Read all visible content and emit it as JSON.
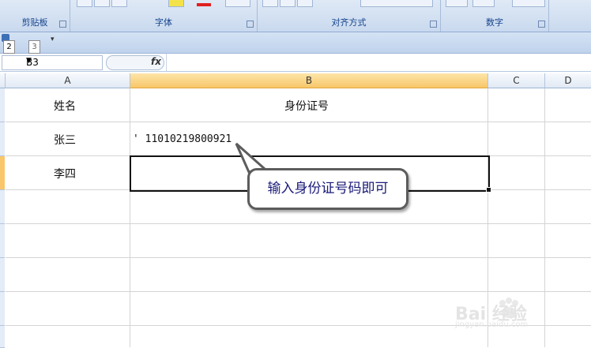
{
  "ribbon": {
    "groups": [
      {
        "label": "剪贴板"
      },
      {
        "label": "字体"
      },
      {
        "label": "对齐方式"
      },
      {
        "label": "数字"
      }
    ]
  },
  "quick_access": {
    "keytips": [
      "2",
      "3"
    ]
  },
  "formula_bar": {
    "name_box": "B3",
    "fx_label": "fx",
    "content": ""
  },
  "grid": {
    "columns": [
      "A",
      "B",
      "C",
      "D"
    ],
    "selected_column": "B",
    "cells": {
      "A1": "姓名",
      "B1": "身份证号",
      "A2": "张三",
      "B2": "' 11010219800921",
      "A3": "李四"
    },
    "active_cell": "B3"
  },
  "callout": {
    "text": "输入身份证号码即可"
  },
  "watermark": {
    "text": "Bai 经验",
    "sub": "jingyan.baidu.com"
  },
  "colors": {
    "selected_header": "#f8c76a",
    "ribbon_text": "#15428b",
    "callout_text": "#1a1a7a"
  }
}
